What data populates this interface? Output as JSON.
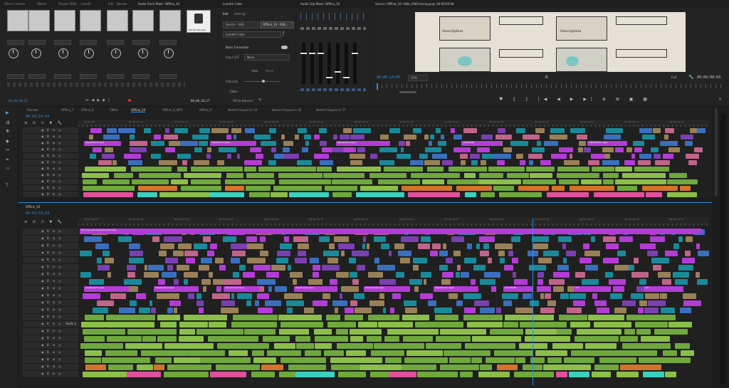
{
  "effect_controls": {
    "tabs": [
      "Effect Controls",
      "Effects",
      "Project: MOR_...r-Jun01",
      "Info",
      "Review",
      "Audio Track Mixer: Offline_10"
    ],
    "source_timecode": "00;00;40;16",
    "thumbnail_label": "Wb Bundle Rear",
    "program_timecode": "00;00;26;17",
    "dropdown_value": "Mix"
  },
  "lumetri": {
    "tabs": [
      "Lumetri Color",
      "Edit",
      "Settings"
    ],
    "source_label": "Source · 048...",
    "target_label": "Offline_10 · 048...",
    "lut_label": "Lumetri Color",
    "section_basic": "Basic Correction",
    "input_lut_label": "Input LUT",
    "input_lut_value": "None",
    "auto_label": "Auto",
    "reset_label": "Reset",
    "intensity_label": "Intensity",
    "color_section": "Color",
    "white_balance_label": "White Balance"
  },
  "audio_clip_mixer": {
    "title": "Audio Clip Mixer: Offline_10"
  },
  "source_monitor": {
    "title": "Source: Offline_10: 048s_0001mixing.png: 00:00:00:00",
    "timecode": "00:00:14:05",
    "zoom": "25%",
    "quality": "Full",
    "duration": "00:00:00:03",
    "panel_text_1": "Description",
    "panel_text_2": "Description"
  },
  "timeline_top": {
    "timecode": "00:03:24:14",
    "tabs": [
      "Remote",
      "Offline_7",
      "Offline_8",
      "CMEle",
      "Offline_10",
      "Offline_6_WTR",
      "Offline_6",
      "Nested Sequence 16",
      "Nested Sequence 36",
      "Nested Sequence 37"
    ],
    "active_tab": 4,
    "ruler_ticks": [
      "00;00;00",
      "00;00;44;22",
      "00;01;29;14",
      "00;02;14;06",
      "00;02;58;28",
      "00;03;43;20",
      "00;04;28;12",
      "00;05;13;04",
      "00;05;57;26",
      "00;06;42;18",
      "00;07;27;10",
      "00;08;12;02",
      "00;08;56;24",
      "00;09;41;16"
    ],
    "clip_labels": [
      "Adjustment Layer",
      "Adjustment Layer",
      "Adjustment Layer",
      "COLOR.MA",
      "Adjustment Layer"
    ]
  },
  "timeline_bottom": {
    "title": "Offline_10",
    "timecode": "00:03:53:03",
    "ruler_ticks": [
      "00;03;00;00",
      "00;03;14;29",
      "00;03;29;28",
      "00;03;44;27",
      "00;03;59;26",
      "00;04;14;25",
      "00;04;29;24",
      "00;04;44;23",
      "00;04;59;22",
      "00;05;14;21",
      "00;05;29;20",
      "00;05;44;19",
      "00;05;59;18",
      "00;06;14;17"
    ],
    "top_clip_label": "MT_Logo_placement(x)_final.png",
    "track_label": "Audio 1",
    "clip_labels": [
      "Adjustment Layer",
      "Adjustment Layer",
      "Adjustment Layer",
      "Adjustment Layer",
      "Adjustment Layer",
      "Adjustment Layer",
      "COLOR.MA",
      "COL",
      "COL"
    ]
  },
  "tools": [
    "selection-tool",
    "track-select-tool",
    "ripple-edit-tool",
    "razor-tool",
    "slip-tool",
    "pen-tool",
    "hand-tool",
    "type-tool"
  ],
  "colors": {
    "accent": "#2e8de0",
    "adjustment": "#b43cd6",
    "teal": "#1a8a9a",
    "green_audio": "#6fa83c",
    "orange": "#d4742a",
    "pink": "#e0509c",
    "cyan_audio": "#3ad0c0",
    "tan": "#9a8058"
  }
}
